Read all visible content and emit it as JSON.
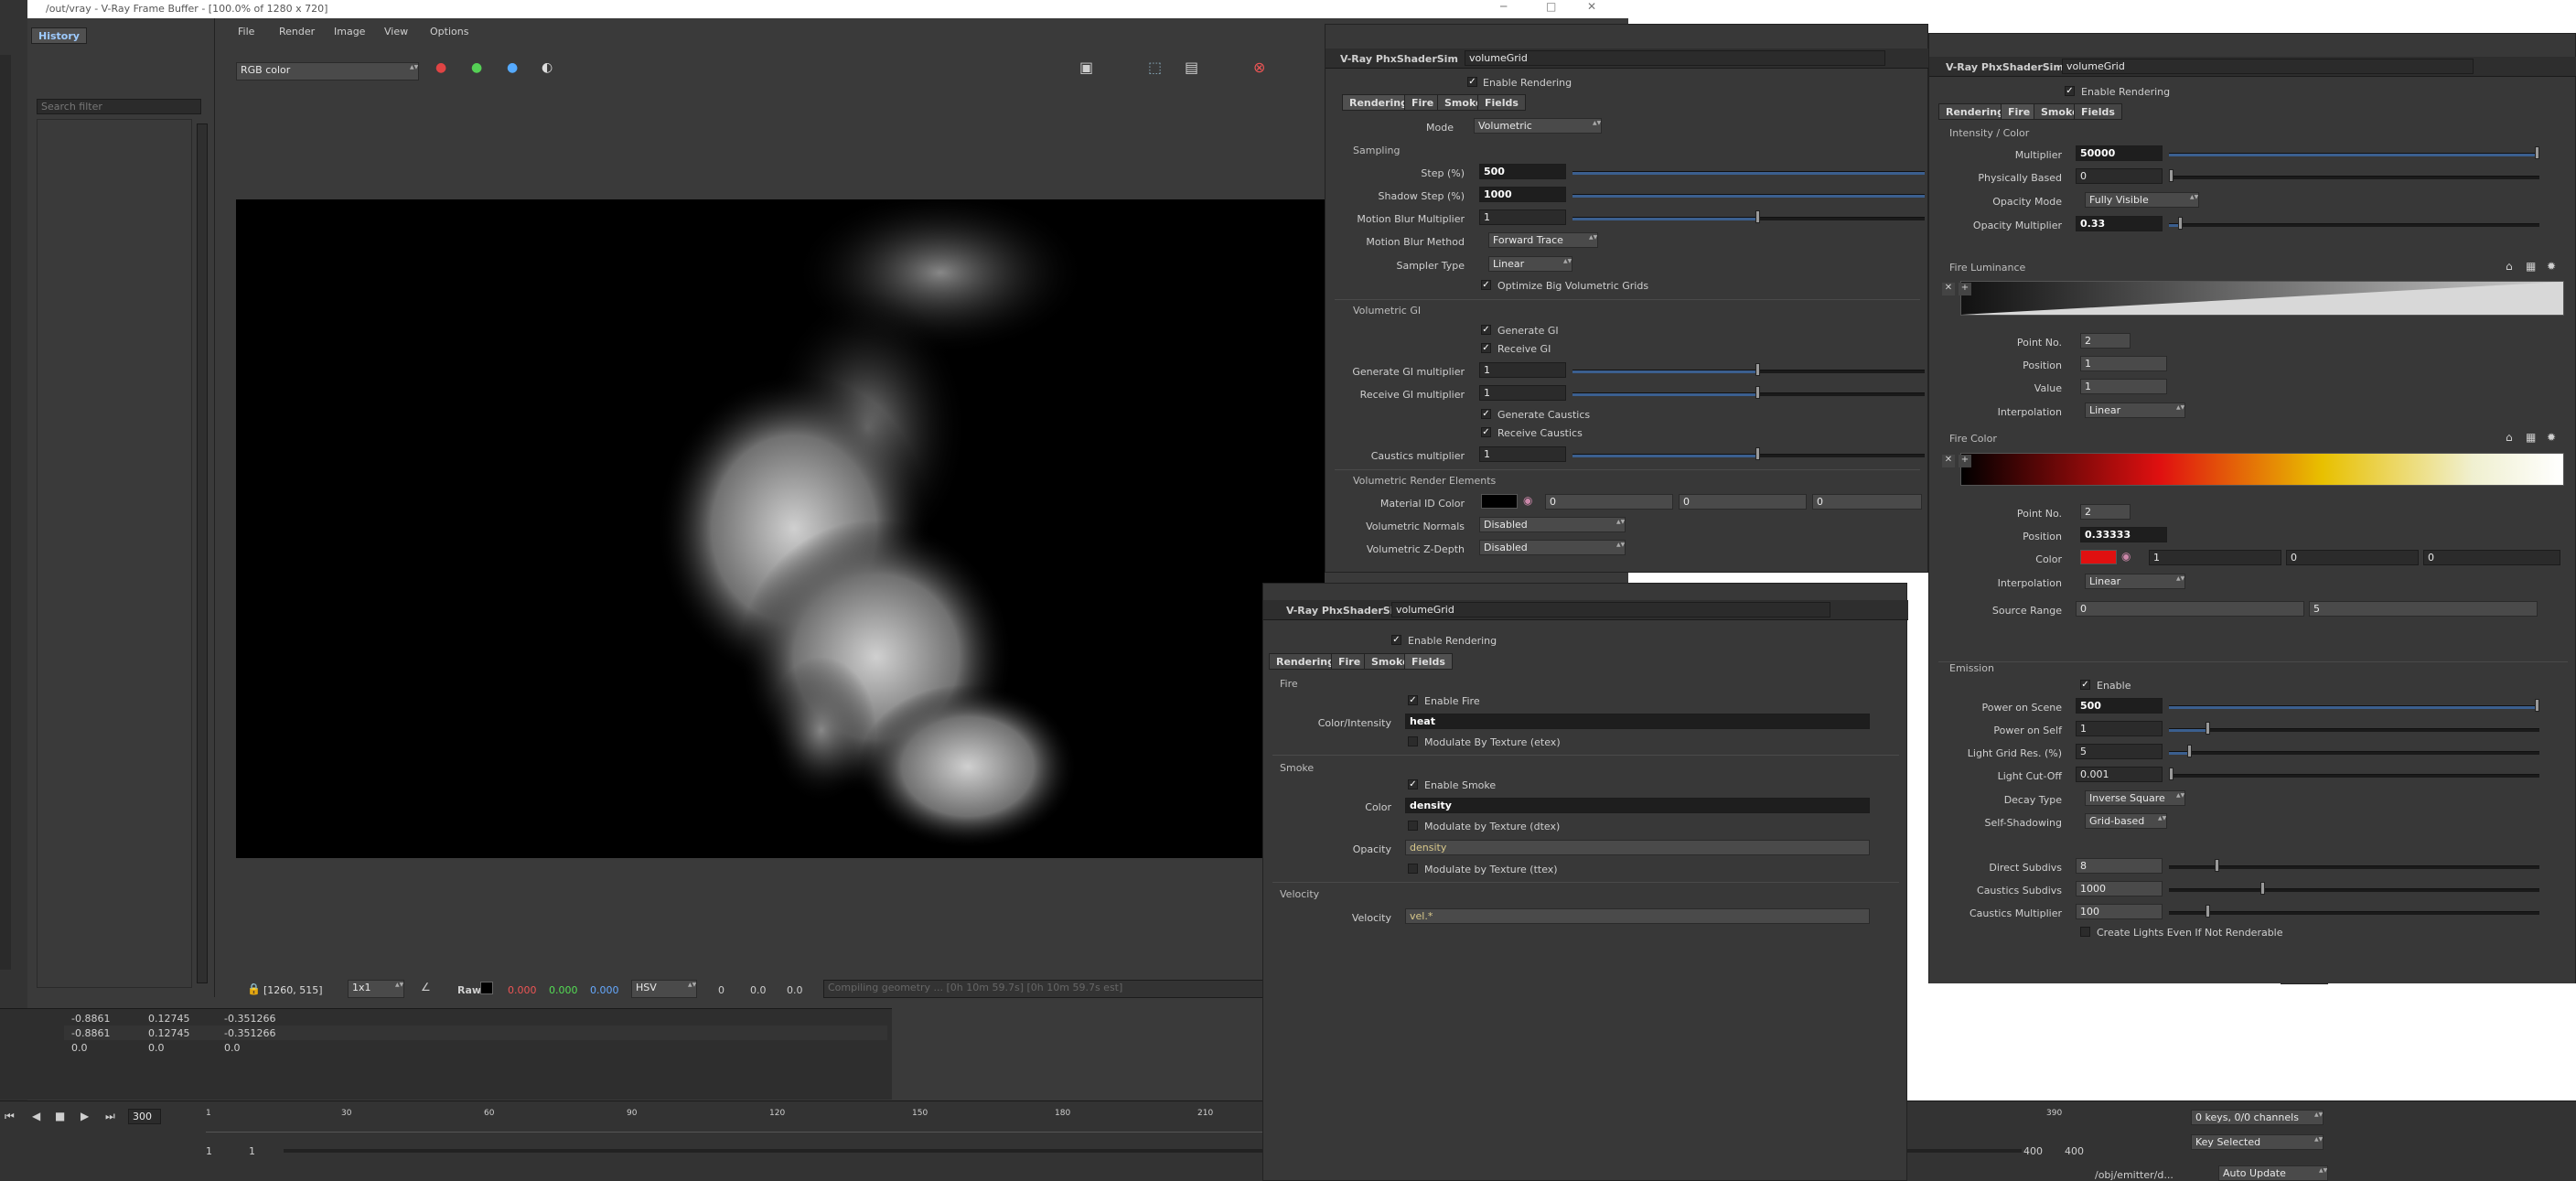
{
  "vfb": {
    "title": "/out/vray - V-Ray Frame Buffer - [100.0% of 1280 x 720]",
    "menu": [
      "File",
      "Render",
      "Image",
      "View",
      "Options"
    ],
    "history_tab": "History",
    "search_placeholder": "Search filter",
    "channel": "RGB color",
    "coords": "[1260, 515]",
    "zoom": "1x1",
    "raw": "Raw",
    "r": "0.000",
    "g": "0.000",
    "b": "0.000",
    "colorspace": "HSV",
    "h": "0",
    "s": "0.0",
    "v": "0.0",
    "status": "Compiling geometry ... [0h 10m 59.7s] [0h 10m 59.7s est]"
  },
  "spreadsheet": {
    "rows": [
      [
        "-0.8861",
        "0.12745",
        "-0.351266"
      ],
      [
        "-0.8861",
        "0.12745",
        "-0.351266"
      ],
      [
        "0.0",
        "0.0",
        "0.0"
      ]
    ]
  },
  "timeline": {
    "frame": "300",
    "ticks": [
      "1",
      "30",
      "60",
      "90",
      "120",
      "150",
      "180",
      "210"
    ],
    "ticks_right": [
      "390"
    ],
    "start": "1",
    "start2": "1",
    "end": "400",
    "end2": "400",
    "keys": "0 keys, 0/0 channels",
    "key_selected": "Key Selected",
    "path": "/obj/emitter/d...",
    "auto_update": "Auto Update"
  },
  "shader": {
    "type": "V-Ray PhxShaderSim",
    "name": "volumeGrid",
    "enable_rendering": "Enable Rendering",
    "tabs": [
      "Rendering",
      "Fire",
      "Smoke",
      "Fields"
    ]
  },
  "rendering_tab": {
    "mode_label": "Mode",
    "mode": "Volumetric",
    "sampling": "Sampling",
    "step_label": "Step (%)",
    "step": "500",
    "shadow_step_label": "Shadow Step (%)",
    "shadow_step": "1000",
    "mb_mult_label": "Motion Blur Multiplier",
    "mb_mult": "1",
    "mb_method_label": "Motion Blur Method",
    "mb_method": "Forward Trace",
    "sampler_label": "Sampler Type",
    "sampler": "Linear",
    "optimize": "Optimize Big Volumetric Grids",
    "vgi": "Volumetric GI",
    "gen_gi": "Generate GI",
    "recv_gi": "Receive GI",
    "gen_gi_mult_label": "Generate GI multiplier",
    "gen_gi_mult": "1",
    "recv_gi_mult_label": "Receive GI multiplier",
    "recv_gi_mult": "1",
    "gen_caustics": "Generate Caustics",
    "recv_caustics": "Receive Caustics",
    "caustics_mult_label": "Caustics multiplier",
    "caustics_mult": "1",
    "vre": "Volumetric Render Elements",
    "matid_label": "Material ID Color",
    "matid": [
      "0",
      "0",
      "0"
    ],
    "vnormals_label": "Volumetric Normals",
    "vnormals": "Disabled",
    "vz_label": "Volumetric Z-Depth",
    "vz": "Disabled"
  },
  "fields_tab": {
    "fire": "Fire",
    "enable_fire": "Enable Fire",
    "ci_label": "Color/Intensity",
    "ci": "heat",
    "mod_etex": "Modulate By Texture (etex)",
    "smoke": "Smoke",
    "enable_smoke": "Enable Smoke",
    "color_label": "Color",
    "color": "density",
    "mod_dtex": "Modulate by Texture (dtex)",
    "opacity_label": "Opacity",
    "opacity": "density",
    "mod_ttex": "Modulate by Texture (ttex)",
    "velocity": "Velocity",
    "vel_label": "Velocity",
    "vel": "vel.*"
  },
  "fire_tab": {
    "ic": "Intensity / Color",
    "mult_label": "Multiplier",
    "mult": "50000",
    "pb_label": "Physically Based",
    "pb": "0",
    "om_label": "Opacity Mode",
    "om": "Fully Visible",
    "omult_label": "Opacity Multiplier",
    "omult": "0.33",
    "fl": "Fire Luminance",
    "pn_label": "Point No.",
    "pn": "2",
    "pos_label": "Position",
    "pos": "1",
    "val_label": "Value",
    "val": "1",
    "interp_label": "Interpolation",
    "interp": "Linear",
    "fc": "Fire Color",
    "pn2": "2",
    "pos2": "0.33333",
    "color_label": "Color",
    "rgb": [
      "1",
      "0",
      "0"
    ],
    "interp2": "Linear",
    "sr_label": "Source Range",
    "sr": [
      "0",
      "5"
    ],
    "emission": "Emission",
    "enable": "Enable",
    "pos_scene_label": "Power on Scene",
    "pos_scene": "500",
    "pos_self_label": "Power on Self",
    "pos_self": "1",
    "lgr_label": "Light Grid Res. (%)",
    "lgr": "5",
    "lco_label": "Light Cut-Off",
    "lco": "0.001",
    "decay_label": "Decay Type",
    "decay": "Inverse Square",
    "ss_label": "Self-Shadowing",
    "ss": "Grid-based",
    "ds_label": "Direct Subdivs",
    "ds": "8",
    "cs_label": "Caustics Subdivs",
    "cs": "1000",
    "cm_label": "Caustics Multiplier",
    "cm": "100",
    "create_lights": "Create Lights Even If Not Renderable"
  },
  "colors": {
    "bg": "#383838",
    "accent": "#3b5f8f",
    "fire_red": "#e01010"
  }
}
